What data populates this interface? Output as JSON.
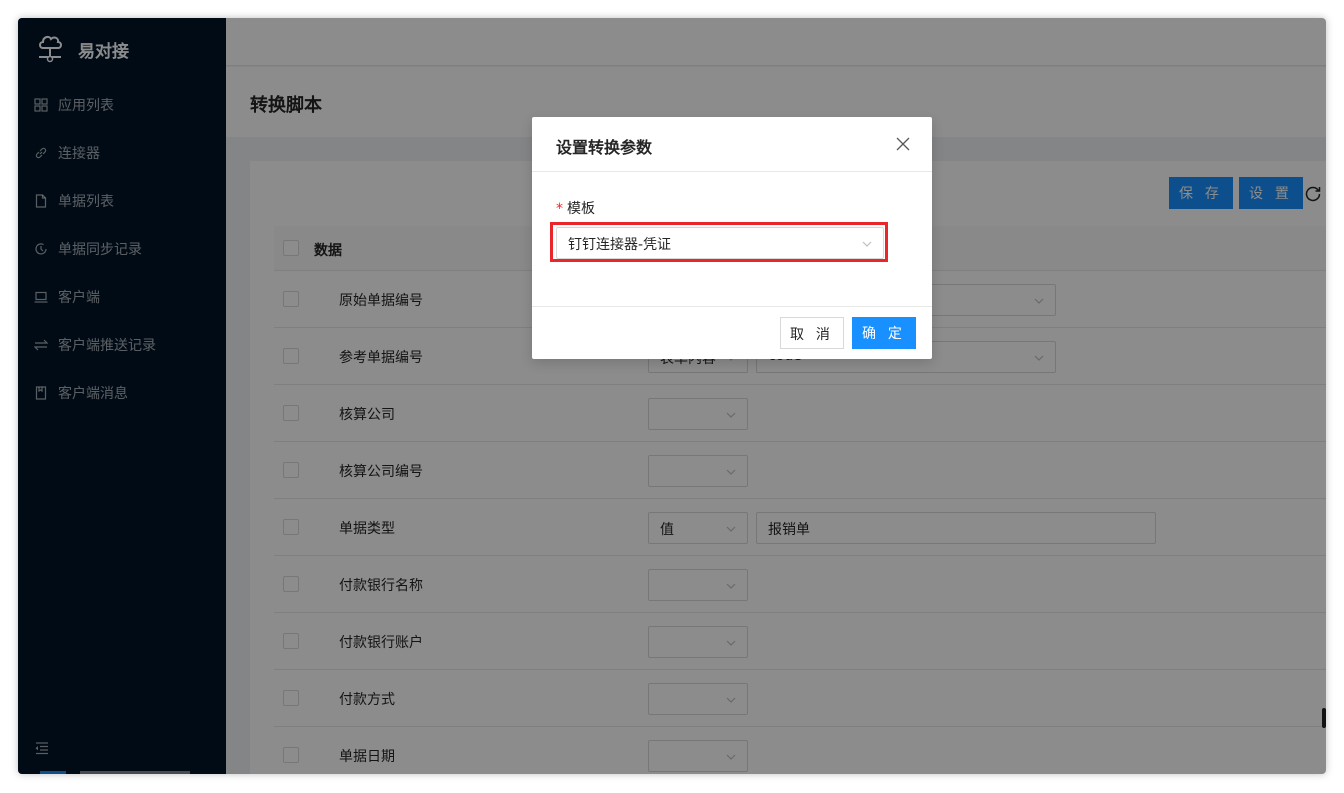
{
  "app": {
    "name": "易对接"
  },
  "sidebar": {
    "items": [
      {
        "label": "应用列表",
        "icon": "appstore-icon"
      },
      {
        "label": "连接器",
        "icon": "link-icon"
      },
      {
        "label": "单据列表",
        "icon": "file-icon"
      },
      {
        "label": "单据同步记录",
        "icon": "history-icon"
      },
      {
        "label": "客户端",
        "icon": "laptop-icon"
      },
      {
        "label": "客户端推送记录",
        "icon": "swap-icon"
      },
      {
        "label": "客户端消息",
        "icon": "message-icon"
      }
    ]
  },
  "page": {
    "title": "转换脚本",
    "save_label": "保 存",
    "settings_label": "设 置"
  },
  "table": {
    "header": "数据",
    "rows": [
      {
        "label": "原始单据编号",
        "type": "",
        "value": ""
      },
      {
        "label": "参考单据编号",
        "type": "表单内容",
        "value": "code"
      },
      {
        "label": "核算公司",
        "type": "",
        "value": ""
      },
      {
        "label": "核算公司编号",
        "type": "",
        "value": ""
      },
      {
        "label": "单据类型",
        "type": "值",
        "value": "报销单"
      },
      {
        "label": "付款银行名称",
        "type": "",
        "value": ""
      },
      {
        "label": "付款银行账户",
        "type": "",
        "value": ""
      },
      {
        "label": "付款方式",
        "type": "",
        "value": ""
      },
      {
        "label": "单据日期",
        "type": "",
        "value": ""
      }
    ]
  },
  "modal": {
    "title": "设置转换参数",
    "required_mark": "*",
    "field_label": "模板",
    "selected_template": "钉钉连接器-凭证",
    "cancel_label": "取 消",
    "ok_label": "确 定"
  },
  "colors": {
    "sidebar_bg": "#001529",
    "primary": "#1890ff",
    "highlight": "#e8262b"
  }
}
